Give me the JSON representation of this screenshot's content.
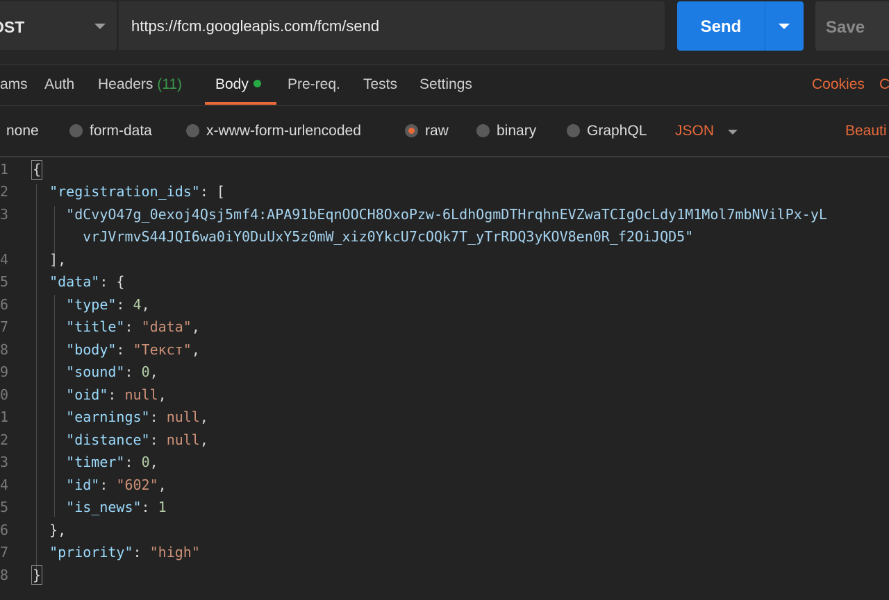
{
  "request": {
    "method": "POST",
    "method_visible": "OST",
    "url": "https://fcm.googleapis.com/fcm/send",
    "send_label": "Send",
    "save_label": "Save"
  },
  "tabs": {
    "params": "ams",
    "auth": "Auth",
    "headers": "Headers",
    "headers_count": "(11)",
    "body": "Body",
    "prereq": "Pre-req.",
    "tests": "Tests",
    "settings": "Settings",
    "cookies": "Cookies",
    "code": "C"
  },
  "body_types": {
    "none": "none",
    "form_data": "form-data",
    "urlencoded": "x-www-form-urlencoded",
    "raw": "raw",
    "binary": "binary",
    "graphql": "GraphQL",
    "selected": "raw",
    "language": "JSON",
    "beautify": "Beauti"
  },
  "editor": {
    "line_numbers": [
      "1",
      "2",
      "3",
      "",
      "4",
      "5",
      "6",
      "7",
      "8",
      "9",
      "0",
      "1",
      "2",
      "3",
      "4",
      "5",
      "6",
      "7",
      "8"
    ],
    "registration_id_part1": "\"dCvyO47g_0exoj4Qsj5mf4:APA91bEqnOOCH8OxoPzw-6LdhOgmDTHrqhnEVZwaTCIgOcLdy1M1Mol7mbNVilPx-yL",
    "registration_id_part2": "vrJVrmvS44JQI6wa0iY0DuUxY5z0mW_xiz0YkcU7cOQk7T_yTrRDQ3yKOV8en0R_f2OiJQD5\"",
    "keys": {
      "registration_ids": "\"registration_ids\"",
      "data": "\"data\"",
      "type": "\"type\"",
      "title": "\"title\"",
      "body": "\"body\"",
      "sound": "\"sound\"",
      "oid": "\"oid\"",
      "earnings": "\"earnings\"",
      "distance": "\"distance\"",
      "timer": "\"timer\"",
      "id": "\"id\"",
      "is_news": "\"is_news\"",
      "priority": "\"priority\""
    },
    "values": {
      "type": "4",
      "title": "\"data\"",
      "body": "\"Текст\"",
      "sound": "0",
      "oid": "null",
      "earnings": "null",
      "distance": "null",
      "timer": "0",
      "id": "\"602\"",
      "is_news": "1",
      "priority": "\"high\""
    }
  },
  "colors": {
    "accent": "#e8693a",
    "send": "#1c7ce4",
    "key": "#9cdcfe",
    "string": "#ce9178",
    "number": "#b5cea8"
  }
}
